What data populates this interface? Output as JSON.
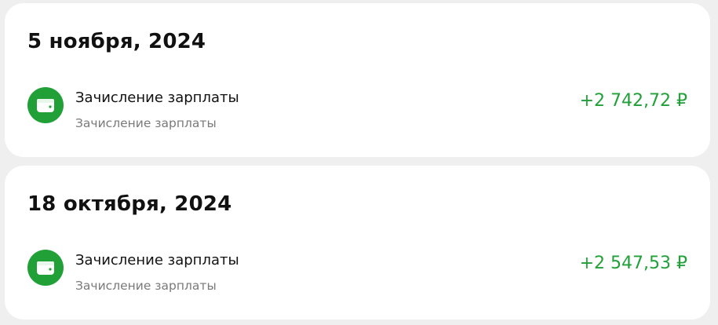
{
  "groups": [
    {
      "date": "5 ноября, 2024",
      "transactions": [
        {
          "title": "Зачисление зарплаты",
          "subtitle": "Зачисление зарплаты",
          "amount": "+2 742,72 ₽",
          "icon": "wallet-icon"
        }
      ]
    },
    {
      "date": "18 октября, 2024",
      "transactions": [
        {
          "title": "Зачисление зарплаты",
          "subtitle": "Зачисление зарплаты",
          "amount": "+2 547,53 ₽",
          "icon": "wallet-icon"
        }
      ]
    }
  ],
  "colors": {
    "accent": "#21a038",
    "background": "#efefef",
    "card": "#ffffff",
    "secondary_text": "#7a7a7a"
  }
}
